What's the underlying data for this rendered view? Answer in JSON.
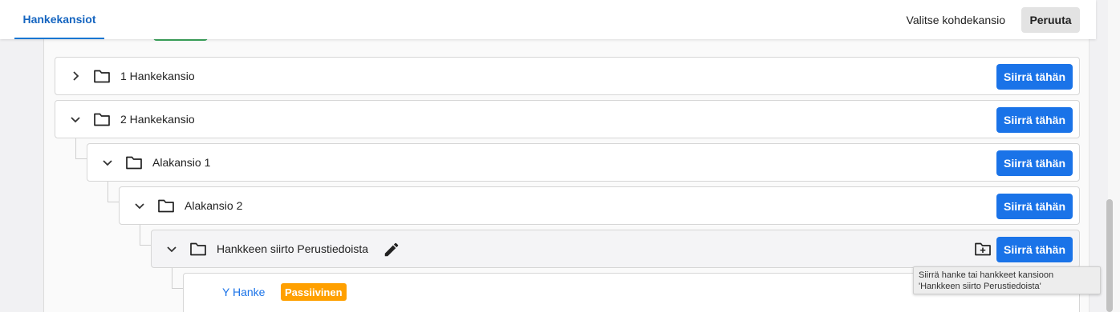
{
  "header": {
    "tab_label": "Hankekansiot",
    "target_label": "Valitse kohdekansio",
    "cancel_label": "Peruuta"
  },
  "tree": [
    {
      "label": "1 Hankekansio",
      "expanded": false,
      "action": "Siirrä tähän"
    },
    {
      "label": "2 Hankekansio",
      "expanded": true,
      "action": "Siirrä tähän"
    },
    {
      "label": "Alakansio 1",
      "expanded": true,
      "action": "Siirrä tähän"
    },
    {
      "label": "Alakansio 2",
      "expanded": true,
      "action": "Siirrä tähän"
    },
    {
      "label": "Hankkeen siirto Perustiedoista",
      "expanded": true,
      "action": "Siirrä tähän"
    }
  ],
  "project": {
    "name": "Y Hanke",
    "status": "Passiivinen",
    "status_color": "#ffa000"
  },
  "tooltip": "Siirrä hanke tai hankkeet kansioon 'Hankkeen siirto Perustiedoista'",
  "colors": {
    "accent": "#1a73e8",
    "green_badge": "#3ba55c"
  },
  "icons": [
    "chevron-right-icon",
    "chevron-down-icon",
    "folder-icon",
    "edit-icon",
    "new-folder-icon"
  ]
}
